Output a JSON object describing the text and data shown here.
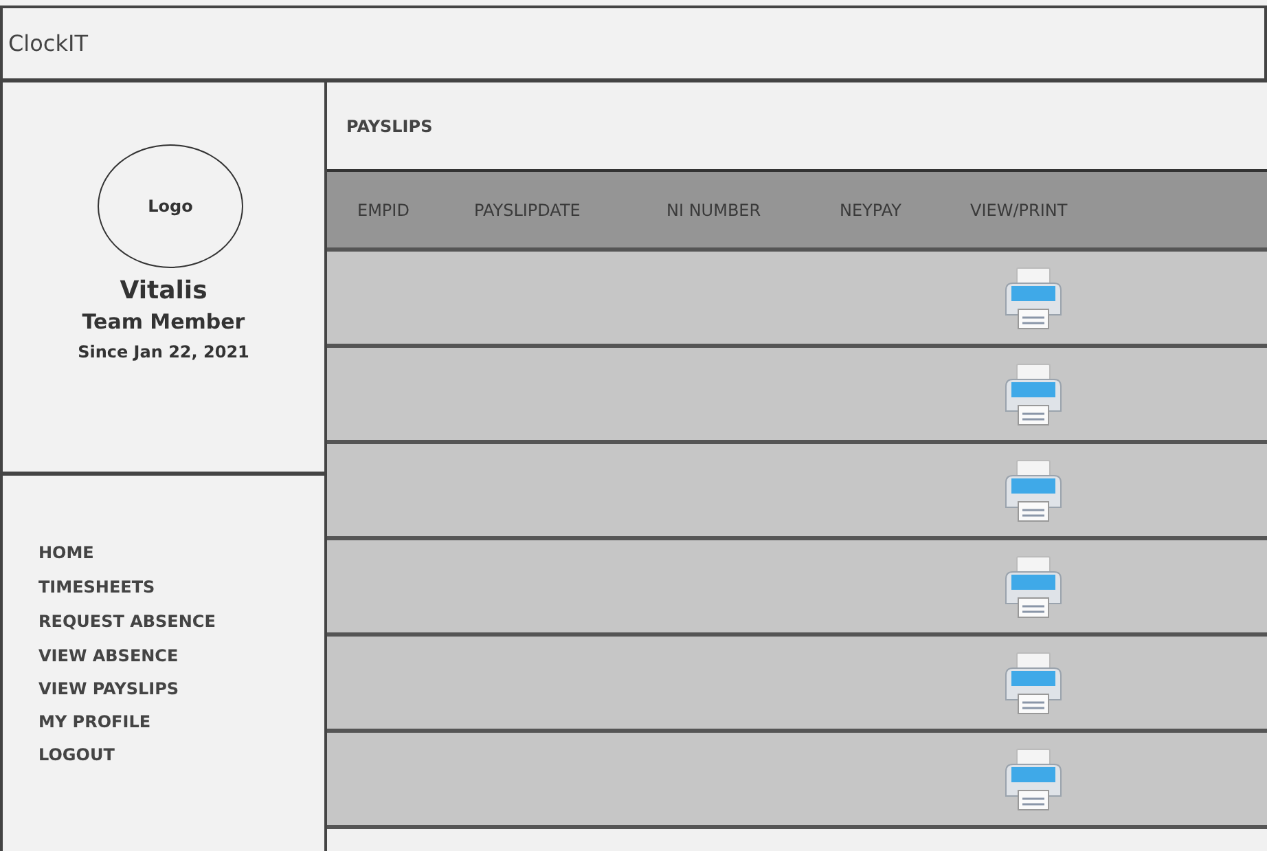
{
  "app_title": "ClockIT",
  "profile": {
    "logo": "Logo",
    "name": "Vitalis",
    "role": "Team Member",
    "since": "Since Jan 22, 2021"
  },
  "nav": [
    "HOME",
    "TIMESHEETS",
    "REQUEST ABSENCE",
    "VIEW ABSENCE",
    "VIEW PAYSLIPS",
    "MY PROFILE",
    "LOGOUT"
  ],
  "page_title": "PAYSLIPS",
  "table": {
    "columns": [
      "EMPID",
      "PAYSLIPDATE",
      "NI NUMBER",
      "NEYPAY",
      "VIEW/PRINT"
    ],
    "rows": [
      {
        "printable": true
      },
      {
        "printable": true
      },
      {
        "printable": true
      },
      {
        "printable": true
      },
      {
        "printable": true
      },
      {
        "printable": true
      }
    ]
  }
}
